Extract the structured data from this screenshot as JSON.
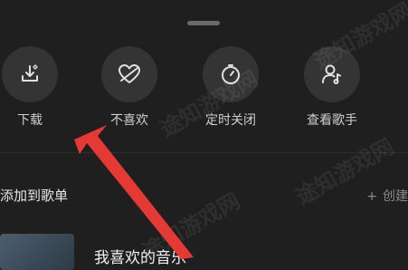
{
  "actions": [
    {
      "label": "下载",
      "icon": "download-icon"
    },
    {
      "label": "不喜欢",
      "icon": "dislike-heart-icon"
    },
    {
      "label": "定时关闭",
      "icon": "timer-icon"
    },
    {
      "label": "查看歌手",
      "icon": "singer-icon"
    }
  ],
  "playlist_section": {
    "title": "添加到歌单",
    "create_label": "创建",
    "create_icon": "plus-icon"
  },
  "playlists": [
    {
      "name": "我喜欢的音乐"
    }
  ],
  "watermark": "途知游戏网",
  "colors": {
    "background": "#1f1f1f",
    "circle": "#343434",
    "annotation_arrow": "#e53935"
  }
}
